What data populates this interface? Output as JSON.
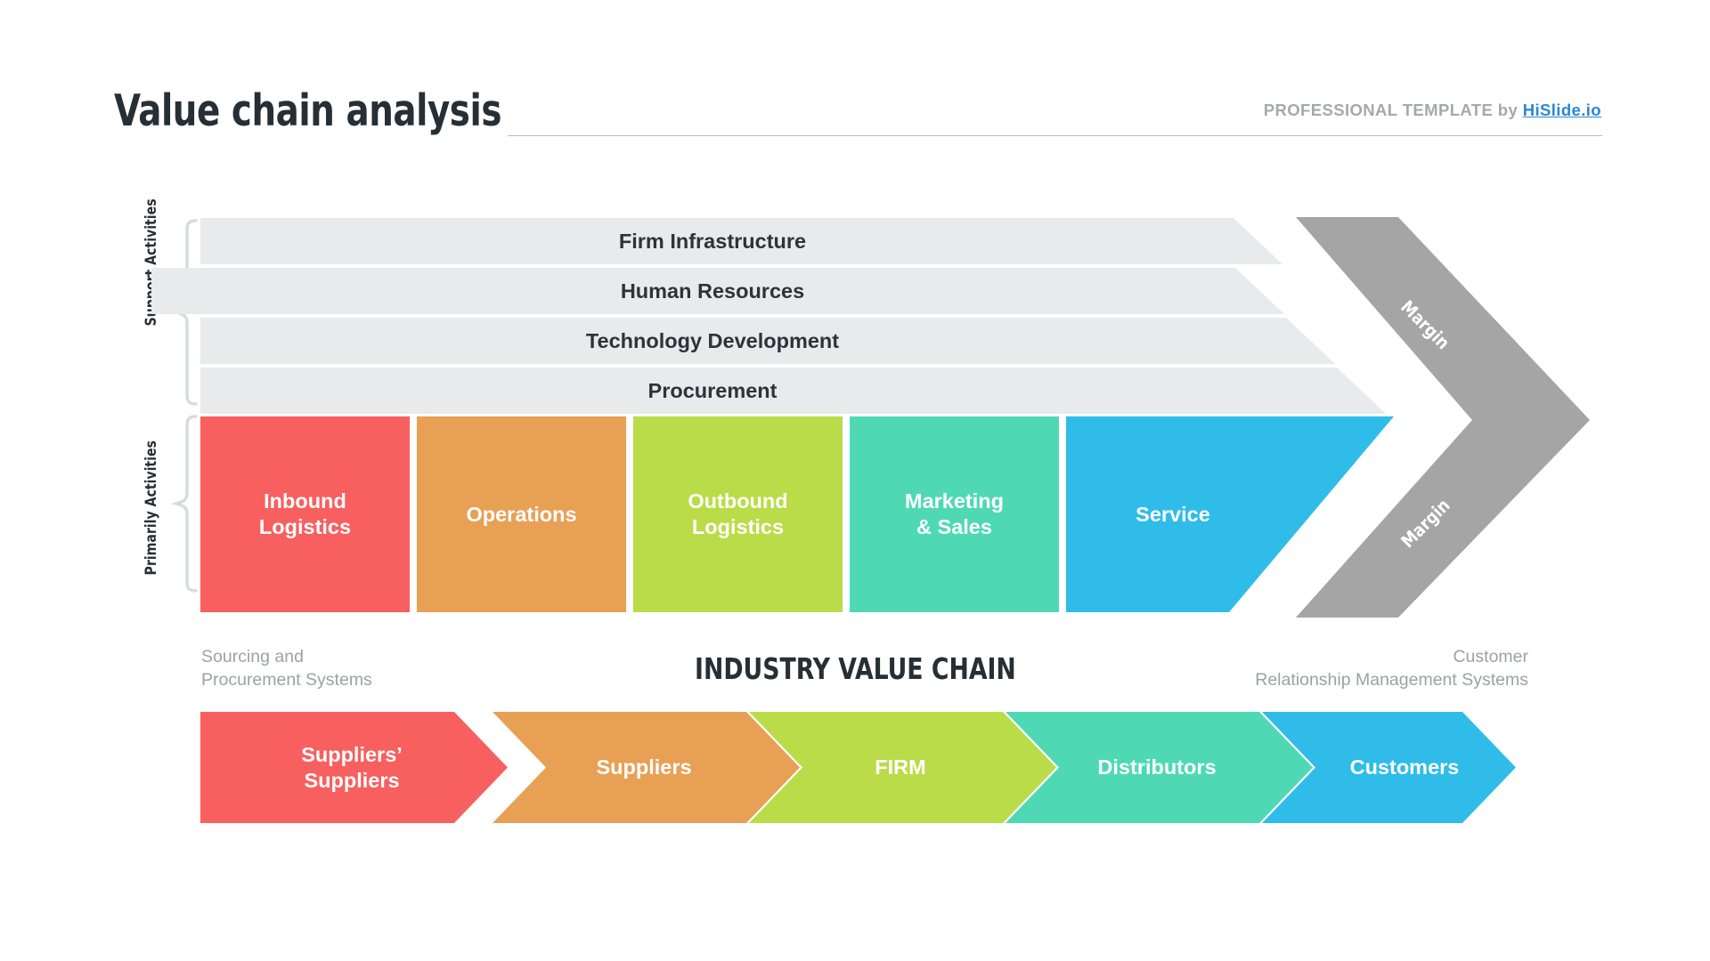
{
  "header": {
    "title": "Value chain analysis",
    "brand_prefix": "PROFESSIONAL TEMPLATE by ",
    "brand_link": "HiSlide.io",
    "brand_link_color": "#2b86d4",
    "title_color": "#262f36",
    "brand_color": "#a6a8ab"
  },
  "axis_labels": {
    "support": "Support Activities",
    "primary": "Primarily Activities"
  },
  "support_activities": {
    "row_color": "#e8eaec",
    "text_color": "#2c333a",
    "rows": [
      {
        "label": "Firm Infrastructure"
      },
      {
        "label": "Human Resources"
      },
      {
        "label": "Technology Development"
      },
      {
        "label": "Procurement"
      }
    ]
  },
  "primary_activities": {
    "text_color": "#ffffff",
    "blocks": [
      {
        "label": "Inbound\nLogistics",
        "color": "#f85f5f"
      },
      {
        "label": "Operations",
        "color": "#e8a055"
      },
      {
        "label": "Outbound\nLogistics",
        "color": "#b9dc48"
      },
      {
        "label": "Marketing\n& Sales",
        "color": "#4ed9b4"
      },
      {
        "label": "Service",
        "color": "#2fbce8"
      }
    ]
  },
  "margin_arrow": {
    "color": "#a5a5a5",
    "label_top": "Margin",
    "label_bottom": "Margin",
    "label_color": "#ffffff"
  },
  "industry_value_chain": {
    "title": "INDUSTRY VALUE CHAIN",
    "caption_left": "Sourcing and\nProcurement Systems",
    "caption_right": "Customer\nRelationship Management Systems",
    "caption_color": "#9ea1a5",
    "steps": [
      {
        "label": "Suppliers’\nSuppliers",
        "color": "#f85f5f"
      },
      {
        "label": "Suppliers",
        "color": "#e8a055"
      },
      {
        "label": "FIRM",
        "color": "#b9dc48"
      },
      {
        "label": "Distributors",
        "color": "#4ed9b4"
      },
      {
        "label": "Customers",
        "color": "#2fbce8"
      }
    ]
  },
  "decor": {
    "brace_color": "#d8dadc",
    "rule_color": "#b9bcbf",
    "background": "#ffffff"
  }
}
